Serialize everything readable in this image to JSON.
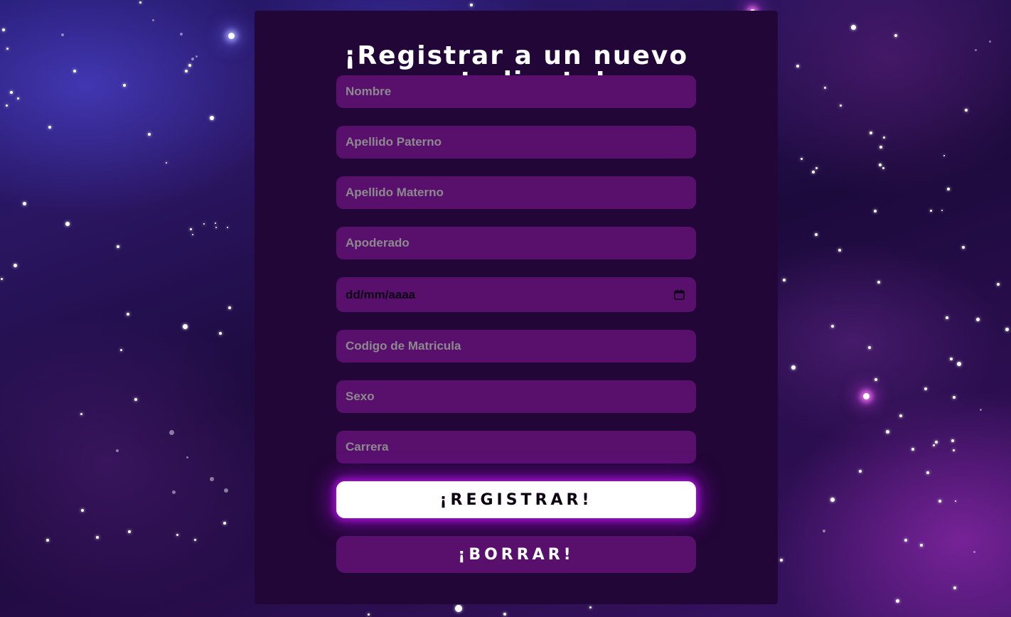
{
  "form": {
    "title": "¡Registrar a un nuevo estudiante!",
    "fields": {
      "nombre": {
        "placeholder": "Nombre",
        "value": ""
      },
      "apellido_paterno": {
        "placeholder": "Apellido Paterno",
        "value": ""
      },
      "apellido_materno": {
        "placeholder": "Apellido Materno",
        "value": ""
      },
      "apoderado": {
        "placeholder": "Apoderado",
        "value": ""
      },
      "fecha": {
        "display": "dd/mm/aaaa",
        "icon": "calendar-icon"
      },
      "codigo_matricula": {
        "placeholder": "Codigo de Matricula",
        "value": ""
      },
      "sexo": {
        "placeholder": "Sexo",
        "value": ""
      },
      "carrera": {
        "placeholder": "Carrera",
        "value": ""
      }
    },
    "buttons": {
      "register_label": "¡REGISTRAR!",
      "clear_label": "¡BORRAR!"
    }
  },
  "colors": {
    "panel_bg": "#220637",
    "field_bg": "#59106d",
    "placeholder": "#8c8a8e",
    "primary_button_bg": "#ffffff",
    "primary_button_glow": "#b414e6",
    "title_text": "#ffffff"
  }
}
